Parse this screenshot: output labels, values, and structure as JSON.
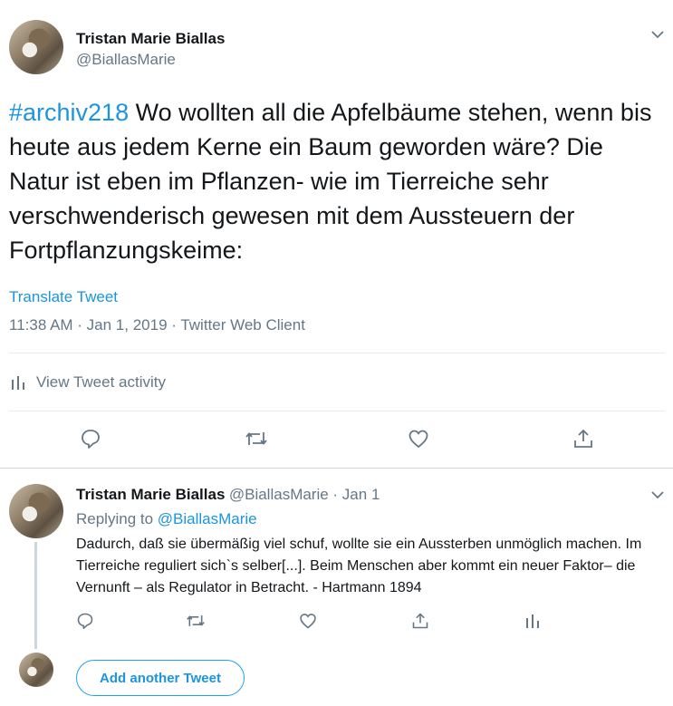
{
  "tweet": {
    "author_name": "Tristan Marie Biallas",
    "author_handle": "@BiallasMarie",
    "hashtag": "#archiv218",
    "text": " Wo wollten all die Apfelbäume stehen, wenn bis heute aus jedem Kerne ein Baum geworden wäre? Die Natur ist eben im Pflanzen- wie im Tierreiche sehr verschwenderisch gewesen mit dem Aussteuern der Fortpflanzungskeime:",
    "translate_label": "Translate Tweet",
    "timestamp": "11:38 AM · Jan 1, 2019 · Twitter Web Client",
    "activity_label": "View Tweet activity"
  },
  "reply": {
    "author_name": "Tristan Marie Biallas",
    "meta": "@BiallasMarie · Jan 1",
    "replying_prefix": "Replying to ",
    "replying_handle": "@BiallasMarie",
    "text": "Dadurch, daß sie übermäßig viel schuf, wollte sie ein Aussterben unmöglich machen. Im Tierreiche reguliert sich`s selber[...]. Beim Menschen aber kommt ein neuer Faktor– die Vernunft – als Regulator in Betracht. - Hartmann 1894"
  },
  "composer": {
    "add_label": "Add another Tweet"
  },
  "icons": {
    "reply": "reply-icon",
    "retweet": "retweet-icon",
    "like": "heart-icon",
    "share": "share-icon",
    "analytics": "analytics-icon",
    "menu": "chevron-down-icon"
  },
  "colors": {
    "accent": "#1b95e0",
    "secondary_text": "#657786",
    "divider": "#e6ecf0"
  }
}
